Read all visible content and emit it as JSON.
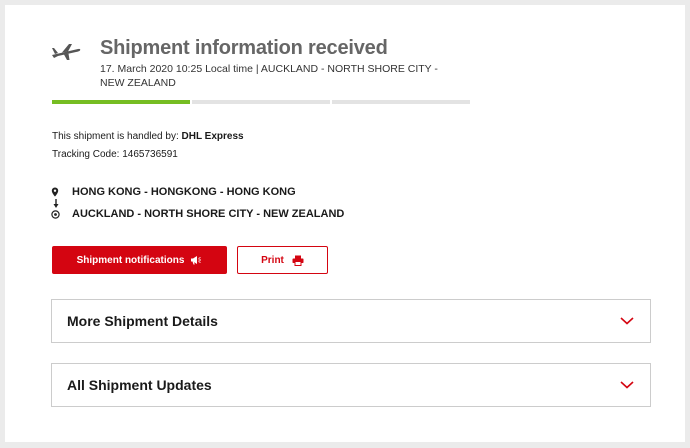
{
  "status": {
    "title": "Shipment information received",
    "details": "17. March 2020 10:25 Local time | AUCKLAND - NORTH SHORE CITY - NEW ZEALAND",
    "progress_completed_segments": 1,
    "progress_total_segments": 3
  },
  "shipment": {
    "handled_label": "This shipment is handled by: ",
    "carrier": "DHL Express",
    "tracking_label": "Tracking Code: ",
    "tracking_code": "1465736591"
  },
  "route": {
    "origin": "HONG KONG - HONGKONG - HONG KONG",
    "destination": "AUCKLAND - NORTH SHORE CITY - NEW ZEALAND"
  },
  "actions": {
    "notifications_label": "Shipment notifications",
    "print_label": "Print"
  },
  "sections": [
    {
      "label": "More Shipment Details"
    },
    {
      "label": "All Shipment Updates"
    }
  ],
  "colors": {
    "brand_red": "#d40511",
    "progress_done": "#76bd22",
    "progress_pending": "#e3e3e3",
    "title_gray": "#666666"
  },
  "icons": {
    "status": "airplane-icon",
    "origin": "location-pin-icon",
    "route": "arrow-down-icon",
    "destination": "target-icon",
    "notifications": "megaphone-icon",
    "print": "printer-icon",
    "expand": "chevron-down-icon"
  }
}
